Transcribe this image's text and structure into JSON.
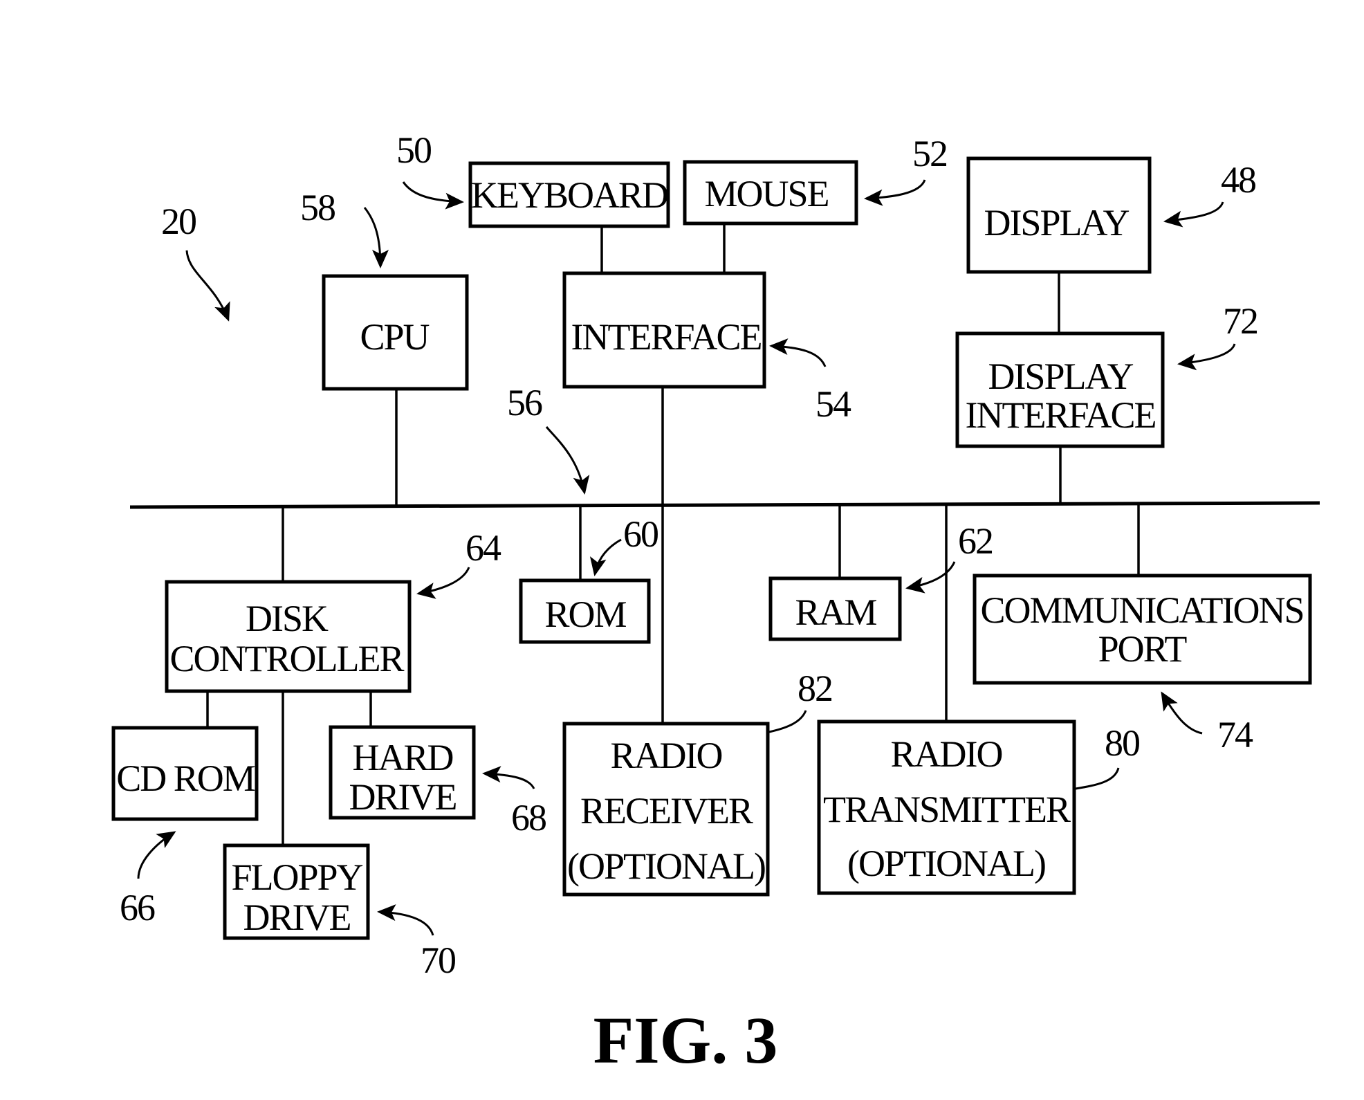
{
  "figure": {
    "caption": "FIG. 3",
    "system_ref": "20",
    "bus_ref": "56"
  },
  "blocks": {
    "keyboard": {
      "lines": [
        "KEYBOARD"
      ],
      "ref": "50"
    },
    "mouse": {
      "lines": [
        "MOUSE"
      ],
      "ref": "52"
    },
    "display": {
      "lines": [
        "DISPLAY"
      ],
      "ref": "48"
    },
    "cpu": {
      "lines": [
        "CPU"
      ],
      "ref": "58"
    },
    "interface": {
      "lines": [
        "INTERFACE"
      ],
      "ref": "54"
    },
    "display_interface": {
      "lines": [
        "DISPLAY",
        "INTERFACE"
      ],
      "ref": "72"
    },
    "disk_controller": {
      "lines": [
        "DISK",
        "CONTROLLER"
      ],
      "ref": "64"
    },
    "rom": {
      "lines": [
        "ROM"
      ],
      "ref": "60"
    },
    "ram": {
      "lines": [
        "RAM"
      ],
      "ref": "62"
    },
    "communications_port": {
      "lines": [
        "COMMUNICATIONS",
        "PORT"
      ],
      "ref": "74"
    },
    "cd_rom": {
      "lines": [
        "CD ROM"
      ],
      "ref": "66"
    },
    "hard_drive": {
      "lines": [
        "HARD",
        "DRIVE"
      ],
      "ref": "68"
    },
    "floppy_drive": {
      "lines": [
        "FLOPPY",
        "DRIVE"
      ],
      "ref": "70"
    },
    "radio_receiver": {
      "lines": [
        "RADIO",
        "RECEIVER",
        "(OPTIONAL)"
      ],
      "ref": "82"
    },
    "radio_transmitter": {
      "lines": [
        "RADIO",
        "TRANSMITTER",
        "(OPTIONAL)"
      ],
      "ref": "80"
    }
  }
}
